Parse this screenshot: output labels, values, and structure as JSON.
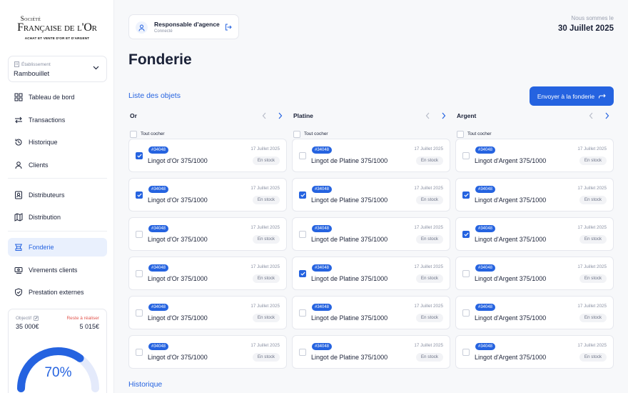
{
  "brand": {
    "line1": "Société",
    "line2": "Française de l'Or",
    "tagline": "ACHAT ET VENTE D'OR ET D'ARGENT"
  },
  "establishment": {
    "label": "Établissement",
    "value": "Rambouillet"
  },
  "nav": [
    {
      "label": "Tableau de bord",
      "icon": "dashboard-icon"
    },
    {
      "label": "Transactions",
      "icon": "transfer-icon"
    },
    {
      "label": "Historique",
      "icon": "history-icon"
    },
    {
      "label": "Clients",
      "icon": "user-icon"
    },
    {
      "label": "Distributeurs",
      "icon": "distributor-icon"
    },
    {
      "label": "Distribution",
      "icon": "map-icon"
    },
    {
      "label": "Fonderie",
      "icon": "foundry-icon",
      "active": true
    },
    {
      "label": "Virements clients",
      "icon": "transfer-money-icon"
    },
    {
      "label": "Prestation externes",
      "icon": "shield-icon"
    }
  ],
  "goal": {
    "label": "Objectif",
    "value": "35 000€",
    "remaining_label": "Reste à réaliser",
    "remaining_value": "5 015€",
    "percent_text": "70%",
    "progress": 0.7
  },
  "user": {
    "name": "Responsable d'agence",
    "status": "Connecté"
  },
  "date": {
    "label": "Nous sommes le",
    "value": "30 Juillet 2025"
  },
  "page": {
    "title": "Fonderie",
    "list_title": "Liste des objets",
    "history_title": "Historique",
    "send_button": "Envoyer à la fonderie",
    "check_all": "Tout cocher"
  },
  "columns": [
    {
      "name": "Or",
      "items": [
        {
          "tag": "#34048",
          "name": "Lingot d'Or 375/1000",
          "date": "17 Juillet 2025",
          "status": "En stock",
          "checked": true
        },
        {
          "tag": "#34048",
          "name": "Lingot d'Or 375/1000",
          "date": "17 Juillet 2025",
          "status": "En stock",
          "checked": true
        },
        {
          "tag": "#34048",
          "name": "Lingot d'Or 375/1000",
          "date": "17 Juillet 2025",
          "status": "En stock",
          "checked": false
        },
        {
          "tag": "#34048",
          "name": "Lingot d'Or 375/1000",
          "date": "17 Juillet 2025",
          "status": "En stock",
          "checked": false
        },
        {
          "tag": "#34048",
          "name": "Lingot d'Or 375/1000",
          "date": "17 Juillet 2025",
          "status": "En stock",
          "checked": false
        },
        {
          "tag": "#34048",
          "name": "Lingot d'Or 375/1000",
          "date": "17 Juillet 2025",
          "status": "En stock",
          "checked": false
        }
      ]
    },
    {
      "name": "Platine",
      "items": [
        {
          "tag": "#34048",
          "name": "Lingot de Platine 375/1000",
          "date": "17 Juillet 2025",
          "status": "En stock",
          "checked": false
        },
        {
          "tag": "#34048",
          "name": "Lingot de Platine 375/1000",
          "date": "17 Juillet 2025",
          "status": "En stock",
          "checked": true
        },
        {
          "tag": "#34048",
          "name": "Lingot de Platine 375/1000",
          "date": "17 Juillet 2025",
          "status": "En stock",
          "checked": false
        },
        {
          "tag": "#34048",
          "name": "Lingot de Platine 375/1000",
          "date": "17 Juillet 2025",
          "status": "En stock",
          "checked": true
        },
        {
          "tag": "#34048",
          "name": "Lingot de Platine 375/1000",
          "date": "17 Juillet 2025",
          "status": "En stock",
          "checked": false
        },
        {
          "tag": "#34048",
          "name": "Lingot de Platine 375/1000",
          "date": "17 Juillet 2025",
          "status": "En stock",
          "checked": false
        }
      ]
    },
    {
      "name": "Argent",
      "items": [
        {
          "tag": "#34048",
          "name": "Lingot d'Argent 375/1000",
          "date": "17 Juillet 2025",
          "status": "En stock",
          "checked": false
        },
        {
          "tag": "#34048",
          "name": "Lingot d'Argent 375/1000",
          "date": "17 Juillet 2025",
          "status": "En stock",
          "checked": true
        },
        {
          "tag": "#34048",
          "name": "Lingot d'Argent 375/1000",
          "date": "17 Juillet 2025",
          "status": "En stock",
          "checked": true
        },
        {
          "tag": "#34048",
          "name": "Lingot d'Argent 375/1000",
          "date": "17 Juillet 2025",
          "status": "En stock",
          "checked": false
        },
        {
          "tag": "#34048",
          "name": "Lingot d'Argent 375/1000",
          "date": "17 Juillet 2025",
          "status": "En stock",
          "checked": false
        },
        {
          "tag": "#34048",
          "name": "Lingot d'Argent 375/1000",
          "date": "17 Juillet 2025",
          "status": "En stock",
          "checked": false
        }
      ]
    }
  ],
  "colors": {
    "accent": "#2563e0",
    "danger": "#e2554e",
    "active_bg": "#e9f0fd"
  }
}
